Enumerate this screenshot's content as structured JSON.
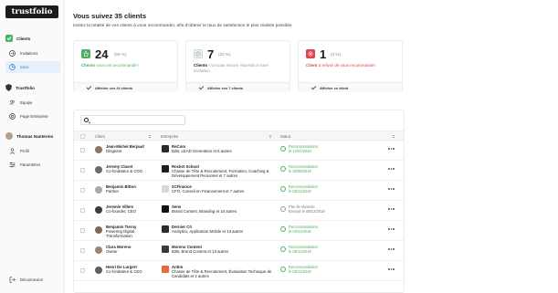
{
  "app": {
    "logo": "trustfolio"
  },
  "sidebar": {
    "clients_head": "Clients",
    "invitations": "Invitations",
    "suivi": "Suivi",
    "company_head": "Trustfolio",
    "equipe": "Equipe",
    "page_entreprise": "Page Entreprise",
    "user_name": "Thomas Nantermo",
    "profil": "Profil",
    "parametres": "Paramètres",
    "deconnexion": "Déconnexion"
  },
  "header": {
    "title": "Vous suivez 35 clients",
    "subtitle": "Invitez la totalité de vos clients à vous recommander, afin d'obtenir le taux de satisfaction le plus réaliste possible."
  },
  "cards": [
    {
      "count": "24",
      "pct": "(69 %)",
      "lead": "Clients",
      "rest": "vous ont recommandé !",
      "footer": "Afficher ces 24 clients",
      "color": "#4fb062"
    },
    {
      "count": "7",
      "pct": "(20 %)",
      "lead": "Clients",
      "rest": "n'ont pas encore répondu à votre invitation.",
      "footer": "Afficher ces 7 clients",
      "color": "#9a9a9a"
    },
    {
      "count": "1",
      "pct": "(3 %)",
      "lead": "Client",
      "rest": "a refusé de vous recommander",
      "footer": "Afficher ce client",
      "color": "#e0434b"
    }
  ],
  "table": {
    "columns": [
      "Client",
      "Entreprise",
      "Statut"
    ],
    "rows": [
      {
        "name": "Jean-Michel Berjaud",
        "role": "Dirigeant",
        "company": "ReCom",
        "desc": "B2B, LEAD Generation et 5 autres",
        "status": "Recommandation",
        "date": "le 14/01/2020",
        "state": "green"
      },
      {
        "name": "Jeremy Clavet",
        "role": "Co-fondateur & COO",
        "company": "Rocket School",
        "desc": "Chasse de Tête & Recrutement, Formation, Coaching & Développement Personnel et 7 autres",
        "status": "Recommandation",
        "date": "le 20/09/2019",
        "state": "green"
      },
      {
        "name": "Benjamin Bitton",
        "role": "Partner",
        "company": "2CFinance",
        "desc": "CFO, Conseil en Financement et 7 autres",
        "status": "Recommandation",
        "date": "le 03/11/2019",
        "state": "green"
      },
      {
        "name": "Jeremie Villers",
        "role": "Co-founder, CEO",
        "company": "Sens",
        "desc": "Brand Content, Branding et 10 autres",
        "status": "Pas de réponse",
        "date": "Envoyé le 09/12/2019",
        "state": "grey"
      },
      {
        "name": "Benjamin Tierny",
        "role": "Powering Digital Transformation",
        "company": "Dernier Cri",
        "desc": "Analytics, Application Mobile et 13 autres",
        "status": "Recommandation",
        "date": "le 03/11/2019",
        "state": "green"
      },
      {
        "name": "Clara Moreno",
        "role": "Owner",
        "company": "Moreno Content",
        "desc": "B2B, Brand Content et 13 autres",
        "status": "Recommandation",
        "date": "le 09/12/2019",
        "state": "green"
      },
      {
        "name": "Henri De Lurgert",
        "role": "Co-fondateur & CEO",
        "company": "Antim",
        "desc": "Chasse de Tête & Recrutement, Évaluation Technique de Candidats et 2 autres",
        "status": "Recommandation",
        "date": "le 03/11/2019",
        "state": "green"
      }
    ]
  }
}
